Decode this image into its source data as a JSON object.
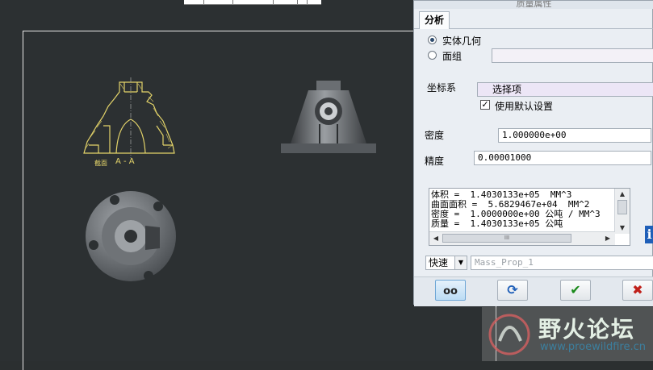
{
  "dialog": {
    "title": "质量属性",
    "tab_analysis": "分析",
    "option_solid": "实体几何",
    "option_quilt": "面组",
    "coord_label": "坐标系",
    "coord_value": "选择项",
    "use_default": "使用默认设置",
    "density_label": "密度",
    "density_value": "1.000000e+00",
    "precision_label": "精度",
    "precision_value": "0.00001000",
    "results": [
      "体积 =  1.4030133e+05  MM^3",
      "曲面面积 =  5.6829467e+04  MM^2",
      "密度 =  1.0000000e+00 公吨 / MM^3",
      "质量 =  1.4030133e+05 公吨"
    ],
    "hscroll_grip": "III",
    "mode_value": "快速",
    "name_placeholder": "Mass_Prop_1",
    "info_glyph": "i"
  },
  "icons": {
    "preview": "glasses-icon",
    "repeat": "refresh-icon",
    "ok": "checkmark-icon",
    "cancel": "close-icon"
  },
  "colors": {
    "ok": "#1a8a1a",
    "cancel": "#c0201a",
    "refresh": "#1f5fb8",
    "section_yellow": "#e4d46a"
  },
  "drawing": {
    "section_label": "A - A",
    "section_prefix": "截面"
  },
  "watermark": {
    "text": "野火论坛",
    "url": "www.proewildfire.cn"
  }
}
